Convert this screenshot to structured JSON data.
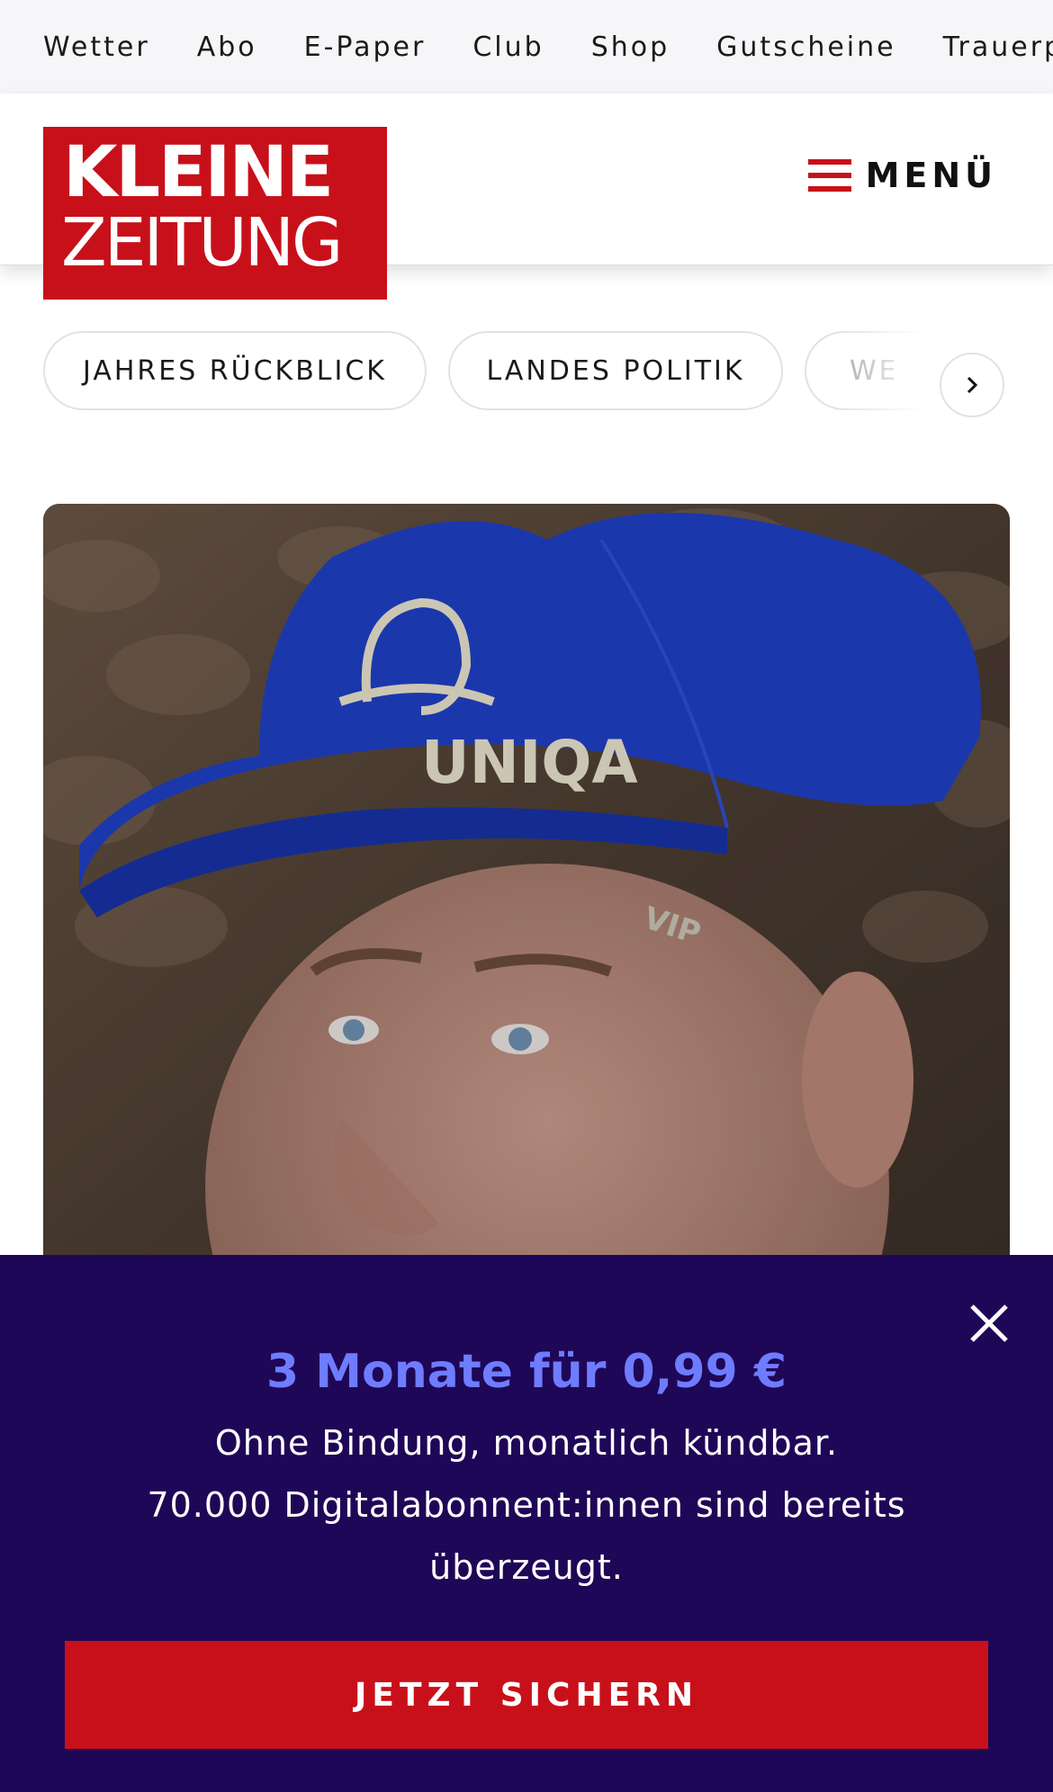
{
  "top_nav": [
    "Wetter",
    "Abo",
    "E-Paper",
    "Club",
    "Shop",
    "Gutscheine",
    "Trauerportal"
  ],
  "logo": {
    "line1": "KLEINE",
    "line2": "ZEITUNG"
  },
  "header": {
    "menu_label": "MENÜ"
  },
  "topics": [
    "JAHRES RÜCKBLICK",
    "LANDES POLITIK",
    "WE"
  ],
  "hero": {
    "cap_brand": "UNIQA",
    "cap_side": "VIP"
  },
  "paywall": {
    "headline": "3 Monate für 0,99 €",
    "line1": "Ohne Bindung, monatlich kündbar.",
    "line2": "70.000 Digitalabonnent:innen sind bereits überzeugt.",
    "cta_label": "JETZT SICHERN"
  },
  "colors": {
    "brand_red": "#c8101a",
    "paywall_bg": "#1f0757",
    "accent_blue": "#6f7cff",
    "cap_blue": "#1f3fc4"
  }
}
